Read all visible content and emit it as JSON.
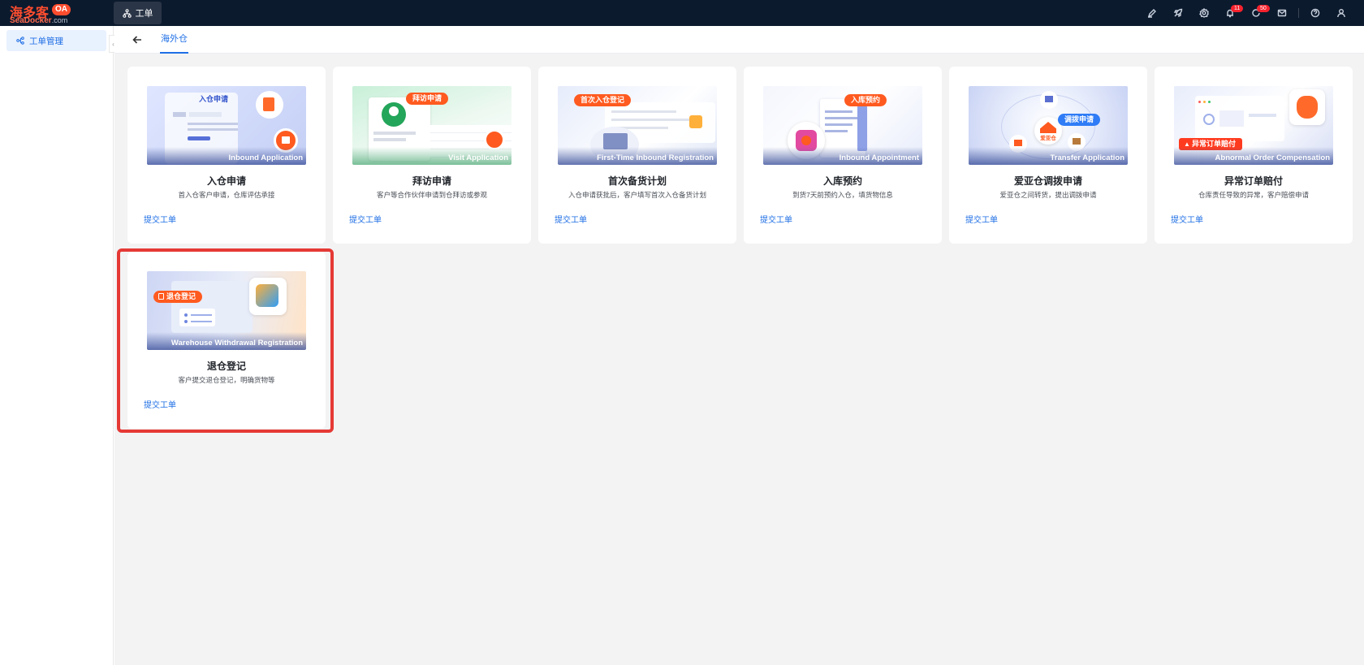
{
  "header": {
    "logo_cn": "海多客",
    "logo_badge": "OA",
    "logo_en": "SeaDocker",
    "logo_en_suffix": ".com",
    "app_tab": "工单",
    "badges": {
      "notifications": "11",
      "tasks": "50"
    }
  },
  "sidebar": {
    "items": [
      {
        "label": "工单管理",
        "icon": "workflow-icon"
      }
    ]
  },
  "breadcrumb": {
    "active_tab": "海外仓"
  },
  "cards": [
    {
      "image_caption": "Inbound Application",
      "image_pill": "入仓申请",
      "title": "入仓申请",
      "desc": "首入仓客户申请，仓库评估承接",
      "link": "提交工单"
    },
    {
      "image_caption": "Visit Application",
      "image_pill": "拜访申请",
      "title": "拜访申请",
      "desc": "客户等合作伙伴申请到仓拜访或参观",
      "link": "提交工单"
    },
    {
      "image_caption": "First-Time Inbound Registration",
      "image_pill": "首次入仓登记",
      "title": "首次备货计划",
      "desc": "入仓申请获批后，客户填写首次入仓备货计划",
      "link": "提交工单"
    },
    {
      "image_caption": "Inbound Appointment",
      "image_pill": "入库预约",
      "title": "入库预约",
      "desc": "到货7天前预约入仓，填货物信息",
      "link": "提交工单"
    },
    {
      "image_caption": "Transfer Application",
      "image_pill": "调拨申请",
      "image_center": "爱亚仓",
      "title": "爱亚仓调拨申请",
      "desc": "爱亚仓之间转货，提出调拨申请",
      "link": "提交工单"
    },
    {
      "image_caption": "Abnormal Order Compensation",
      "image_pill": "异常订单赔付",
      "title": "异常订单赔付",
      "desc": "仓库责任导致的异常，客户赔偿申请",
      "link": "提交工单"
    },
    {
      "image_caption": "Warehouse Withdrawal Registration",
      "image_pill": "退仓登记",
      "title": "退仓登记",
      "desc": "客户提交退仓登记，明确货物等",
      "link": "提交工单"
    }
  ],
  "colors": {
    "accent": "#1f6fe5",
    "header_bg": "#0c1a2e",
    "highlight": "#e53935",
    "pill_orange": "#ff5a1f"
  }
}
